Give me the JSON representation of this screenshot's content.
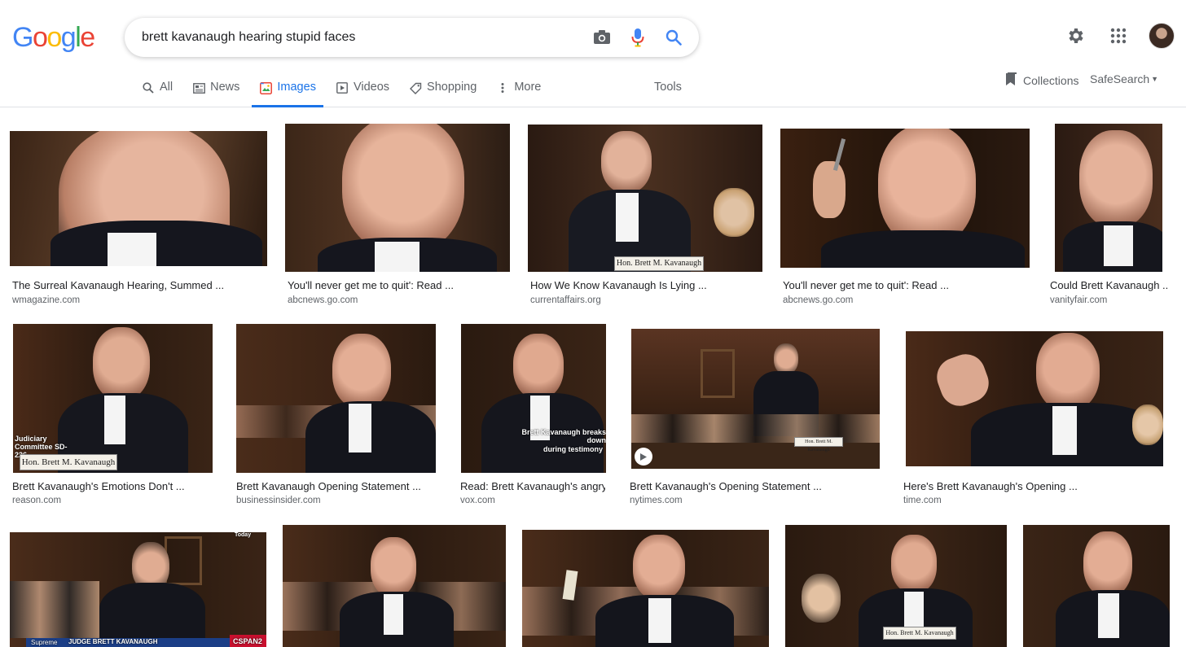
{
  "header": {
    "logo_letters": [
      {
        "ch": "G",
        "color": "#4285F4"
      },
      {
        "ch": "o",
        "color": "#EA4335"
      },
      {
        "ch": "o",
        "color": "#FBBC05"
      },
      {
        "ch": "g",
        "color": "#4285F4"
      },
      {
        "ch": "l",
        "color": "#34A853"
      },
      {
        "ch": "e",
        "color": "#EA4335"
      }
    ],
    "search_query": "brett kavanaugh hearing stupid faces",
    "icons": [
      "camera-icon",
      "microphone-icon",
      "search-icon",
      "gear-icon",
      "apps-icon",
      "avatar"
    ]
  },
  "tabs": [
    {
      "label": "All",
      "icon": "search-icon",
      "active": false
    },
    {
      "label": "News",
      "icon": "news-icon",
      "active": false
    },
    {
      "label": "Images",
      "icon": "images-icon",
      "active": true
    },
    {
      "label": "Videos",
      "icon": "videos-icon",
      "active": false
    },
    {
      "label": "Shopping",
      "icon": "tag-icon",
      "active": false
    },
    {
      "label": "More",
      "icon": "more-vert-icon",
      "active": false
    }
  ],
  "tools_label": "Tools",
  "collections_label": "Collections",
  "safesearch_label": "SafeSearch",
  "accent_color": "#1a73e8",
  "results": [
    {
      "title": "The Surreal Kavanaugh Hearing, Summed ...",
      "source": "wmagazine.com"
    },
    {
      "title": "You'll never get me to quit': Read ...",
      "source": "abcnews.go.com"
    },
    {
      "title": "How We Know Kavanaugh Is Lying ...",
      "source": "currentaffairs.org"
    },
    {
      "title": "You'll never get me to quit': Read ...",
      "source": "abcnews.go.com"
    },
    {
      "title": "Could Brett Kavanaugh ...",
      "source": "vanityfair.com"
    },
    {
      "title": "Brett Kavanaugh's Emotions Don't ...",
      "source": "reason.com"
    },
    {
      "title": "Brett Kavanaugh Opening Statement ...",
      "source": "businessinsider.com"
    },
    {
      "title": "Read: Brett Kavanaugh's angry ...",
      "source": "vox.com"
    },
    {
      "title": "Brett Kavanaugh's Opening Statement ...",
      "source": "nytimes.com"
    },
    {
      "title": "Here's Brett Kavanaugh's Opening ...",
      "source": "time.com"
    }
  ],
  "overlays": {
    "reason_caption": "Judiciary Committee SD-226",
    "reason_nameplate": "Hon. Brett M. Kavanaugh",
    "vox_caption_1": "Brett Kavanaugh breaks down",
    "vox_caption_2": "during testimony",
    "currentaffairs_nameplate": "Hon. Brett M. Kavanaugh",
    "nytimes_nameplate": "Hon. Brett M. Kavanaugh",
    "row3_banner_left": "Supreme",
    "row3_banner_mid": "JUDGE BRETT KAVANAUGH",
    "row3_banner_right": "CSPAN2",
    "row3_today": "Today",
    "row3_nameplate_4": "Hon. Brett M. Kavanaugh"
  }
}
